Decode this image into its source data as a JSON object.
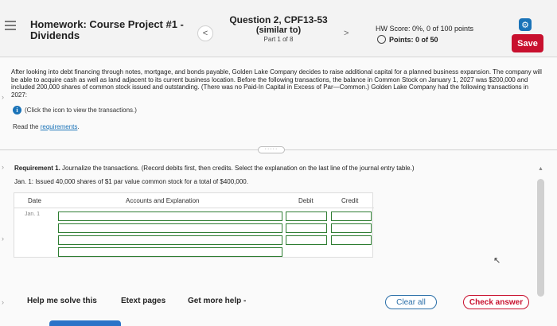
{
  "header": {
    "title_line1": "Homework: Course Project #1 -",
    "title_line2": "Dividends",
    "prev_glyph": "<",
    "next_glyph": ">",
    "question_line1": "Question 2, CPF13-53",
    "question_line2": "(similar to)",
    "question_part": "Part 1 of 8",
    "hw_score": "HW Score: 0%, 0 of 100 points",
    "points": "Points: 0 of 50",
    "save_label": "Save",
    "settings_icon": "gear-icon"
  },
  "content": {
    "paragraph": "After looking into debt financing through notes, mortgage, and bonds payable, Golden Lake Company decides to raise additional capital for a planned business expansion. The company will be able to acquire cash as well as land adjacent to its current business location. Before the following transactions, the balance in Common Stock on January 1, 2027 was $200,000 and included 200,000 shares of common stock issued and outstanding. (There was no Paid-In Capital in Excess of Par—Common.) Golden Lake Company had the following transactions in 2027:",
    "info_text": "(Click the icon to view the transactions.)",
    "read_prefix": "Read the ",
    "read_link": "requirements",
    "read_suffix": ".",
    "divider_label": "·····",
    "requirement_label": "Requirement 1.",
    "requirement_text": " Journalize the transactions. (Record debits first, then credits. Select the explanation on the last line of the journal entry table.)",
    "transaction": "Jan. 1: Issued 40,000 shares of $1 par value common stock for a total of $400,000.",
    "journal": {
      "col_date": "Date",
      "col_accounts": "Accounts and Explanation",
      "col_debit": "Debit",
      "col_credit": "Credit",
      "date_value": "Jan. 1",
      "rows": 4
    }
  },
  "footer": {
    "help_solve": "Help me solve this",
    "etext": "Etext pages",
    "more_help": "Get more help -",
    "clear_label": "Clear all",
    "check_label": "Check answer"
  },
  "colors": {
    "brand_red": "#c8102e",
    "link_blue": "#1a73b8",
    "cell_green": "#2e7d32"
  }
}
